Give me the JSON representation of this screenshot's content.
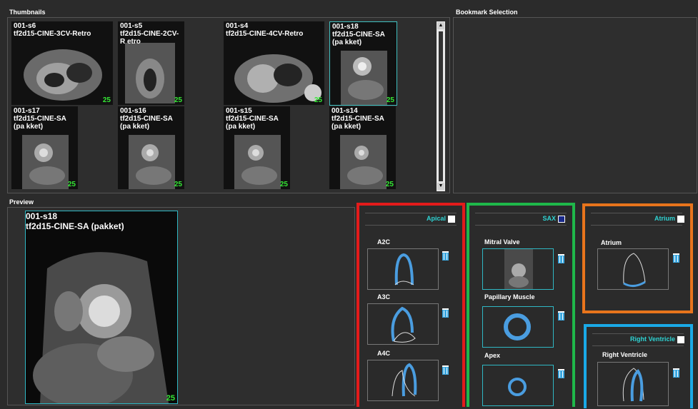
{
  "thumbnails": {
    "header": "Thumbnails",
    "items": [
      {
        "id": "001-s6",
        "desc": "tf2d15-CINE-3CV-Retro",
        "count": "25"
      },
      {
        "id": "001-s5",
        "desc": "tf2d15-CINE-2CV-R etro",
        "count": "25"
      },
      {
        "id": "001-s4",
        "desc": "tf2d15-CINE-4CV-Retro",
        "count": "25"
      },
      {
        "id": "001-s18",
        "desc": "tf2d15-CINE-SA (pa kket)",
        "count": "25"
      },
      {
        "id": "001-s17",
        "desc": "tf2d15-CINE-SA (pa kket)",
        "count": "25"
      },
      {
        "id": "001-s16",
        "desc": "tf2d15-CINE-SA (pa kket)",
        "count": "25"
      },
      {
        "id": "001-s15",
        "desc": "tf2d15-CINE-SA (pa kket)",
        "count": "25"
      },
      {
        "id": "001-s14",
        "desc": "tf2d15-CINE-SA (pa kket)",
        "count": "25"
      }
    ]
  },
  "bookmark": {
    "header": "Bookmark Selection"
  },
  "preview": {
    "header": "Preview",
    "id": "001-s18",
    "desc": "tf2d15-CINE-SA (pakket)",
    "count": "25"
  },
  "apical": {
    "title": "Apical",
    "slots": [
      {
        "label": "A2C"
      },
      {
        "label": "A3C"
      },
      {
        "label": "A4C"
      }
    ]
  },
  "sax": {
    "title": "SAX",
    "slots": [
      {
        "label": "Mitral Valve"
      },
      {
        "label": "Papillary Muscle"
      },
      {
        "label": "Apex"
      }
    ]
  },
  "atrium": {
    "title": "Atrium",
    "slots": [
      {
        "label": "Atrium"
      }
    ]
  },
  "rv": {
    "title": "Right Ventricle",
    "slots": [
      {
        "label": "Right Ventricle"
      }
    ]
  },
  "colors": {
    "apical": "#e31b1b",
    "sax": "#1fb84a",
    "atrium": "#e8741c",
    "rv": "#1aa9e6",
    "accent": "#2ed3d3",
    "count": "#35e835"
  }
}
